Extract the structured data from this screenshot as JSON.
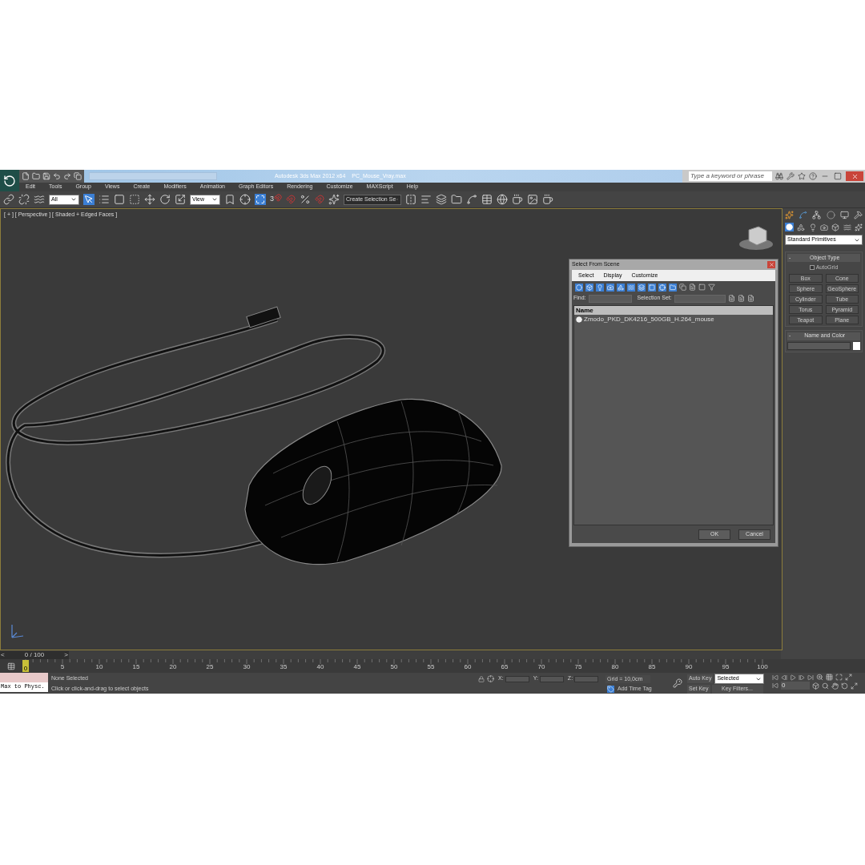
{
  "title_bar": {
    "app_title": "Autodesk 3ds Max 2012 x64",
    "file_name": "PC_Mouse_Vray.max",
    "search": {
      "placeholder": "Type a keyword or phrase"
    }
  },
  "menu": [
    "Edit",
    "Tools",
    "Group",
    "Views",
    "Create",
    "Modifiers",
    "Animation",
    "Graph Editors",
    "Rendering",
    "Customize",
    "MAXScript",
    "Help"
  ],
  "toolbar": {
    "selection_filter": "All",
    "reference_coordinate": "View",
    "snap_label": "3",
    "named_selection": "Create Selection Se"
  },
  "viewport": {
    "label": "[ + ] [ Perspective ] [ Shaded + Edged Faces ]"
  },
  "dialog": {
    "title": "Select From Scene",
    "menu": [
      "Select",
      "Display",
      "Customize"
    ],
    "find_label": "Find:",
    "selection_set_label": "Selection Set:",
    "column": "Name",
    "rows": [
      {
        "name": "Zmodo_PKD_DK4216_500GB_H.264_mouse"
      }
    ],
    "buttons": [
      "OK",
      "Cancel"
    ]
  },
  "command_panel": {
    "category": "Standard Primitives",
    "object_type": {
      "title": "Object Type",
      "collapse": "-",
      "autogrid": {
        "label": "AutoGrid",
        "checked": false
      },
      "buttons": [
        "Box",
        "Cone",
        "Sphere",
        "GeoSphere",
        "Cylinder",
        "Tube",
        "Torus",
        "Pyramid",
        "Teapot",
        "Plane"
      ]
    },
    "name_and_color": {
      "title": "Name and Color",
      "collapse": "-",
      "color": "#ffffff"
    }
  },
  "timeline": {
    "prev": "<",
    "frame_slider": "0 / 100",
    "next": ">",
    "level": 0,
    "thumb": "0",
    "ticks": [
      "5",
      "10",
      "15",
      "20",
      "25",
      "30",
      "35",
      "40",
      "45",
      "50",
      "55",
      "60",
      "65",
      "70",
      "75",
      "80",
      "85",
      "90",
      "95",
      "100"
    ]
  },
  "status": {
    "listener_label": "Max to Physc.",
    "selection": "None Selected",
    "prompt": "Click or click-and-drag to select objects",
    "x_label": "X:",
    "y_label": "Y:",
    "z_label": "Z:",
    "grid": "Grid = 10,0cm",
    "add_time_tag": "Add Time Tag",
    "auto_key": "Auto Key",
    "key_mode": "Selected",
    "set_key": "Set Key",
    "key_filters": "Key Filters...",
    "current_frame": "0"
  }
}
